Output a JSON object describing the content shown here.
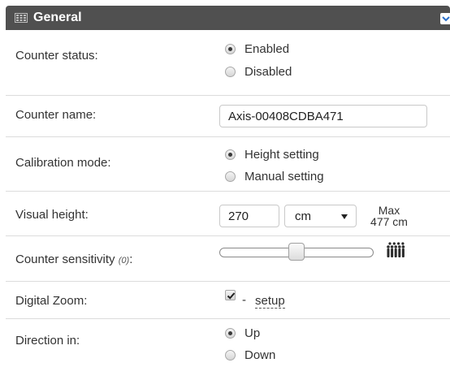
{
  "panel": {
    "title": "General",
    "header_icon": "settings-grid-icon",
    "collapse_icon": "chevron-down-icon",
    "colors": {
      "header_bg": "#505050",
      "header_text": "#ffffff",
      "collapse_icon": "#2a6fc9",
      "row_divider": "#dcdcdc"
    }
  },
  "counter_status": {
    "label": "Counter status:",
    "options": [
      {
        "label": "Enabled",
        "checked": true
      },
      {
        "label": "Disabled",
        "checked": false
      }
    ]
  },
  "counter_name": {
    "label": "Counter name:",
    "value": "Axis-00408CDBA471"
  },
  "calibration_mode": {
    "label": "Calibration mode:",
    "options": [
      {
        "label": "Height setting",
        "checked": true
      },
      {
        "label": "Manual setting",
        "checked": false
      }
    ]
  },
  "visual_height": {
    "label": "Visual height:",
    "value": "270",
    "unit": "cm",
    "max_line1": "Max",
    "max_line2": "477 cm"
  },
  "counter_sensitivity": {
    "label": "Counter sensitivity",
    "note": "(0)",
    "suffix": ":",
    "slider_value_fraction": 0.5,
    "icon": "crowd-icon"
  },
  "digital_zoom": {
    "label": "Digital Zoom:",
    "checked": true,
    "dash": "-",
    "link": "setup"
  },
  "direction_in": {
    "label": "Direction in:",
    "options": [
      {
        "label": "Up",
        "checked": true
      },
      {
        "label": "Down",
        "checked": false
      }
    ]
  }
}
